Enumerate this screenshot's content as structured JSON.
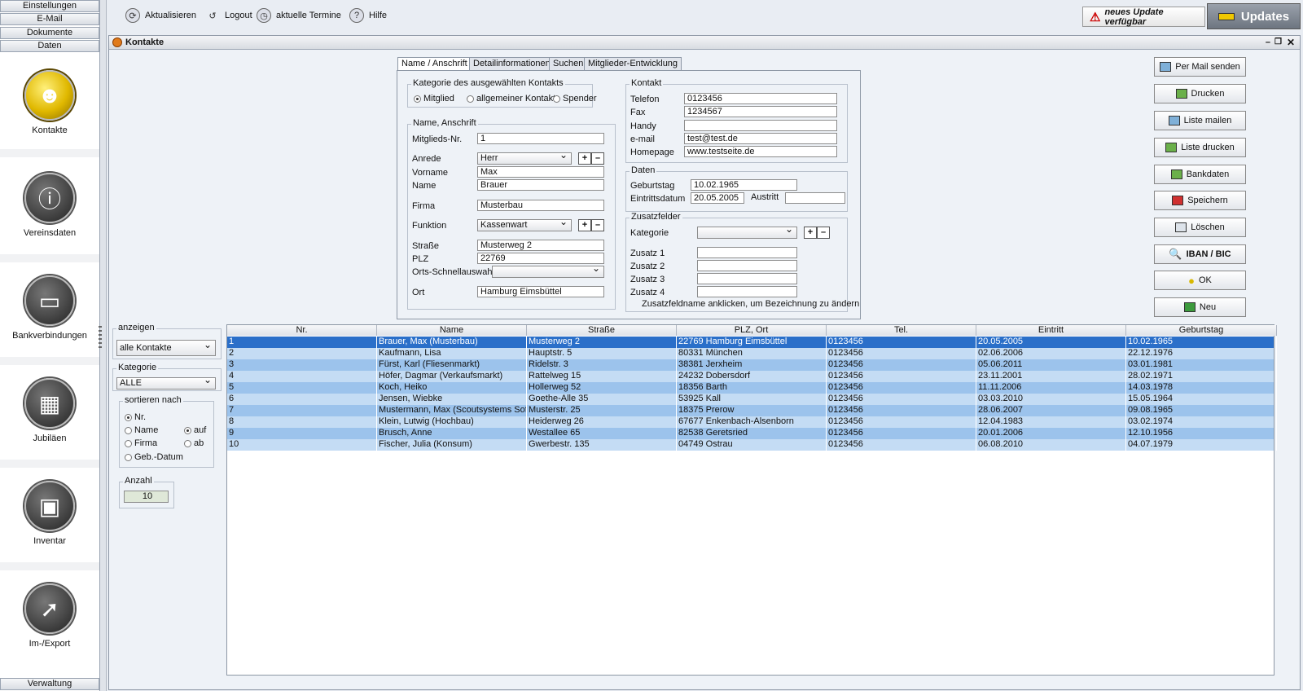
{
  "sidebar": {
    "top_menu": [
      "Einstellungen",
      "E-Mail",
      "Dokumente",
      "Daten"
    ],
    "items": [
      {
        "label": "Kontakte",
        "icon": "person-icon"
      },
      {
        "label": "Vereinsdaten",
        "icon": "info-icon"
      },
      {
        "label": "Bankverbindungen",
        "icon": "credit-card-icon"
      },
      {
        "label": "Jubiläen",
        "icon": "calendar-icon"
      },
      {
        "label": "Inventar",
        "icon": "briefcase-icon"
      },
      {
        "label": "Im-/Export",
        "icon": "export-icon"
      }
    ],
    "bottom_menu": "Verwaltung"
  },
  "toolbar": {
    "refresh": "Aktualisieren",
    "logout": "Logout",
    "appointments": "aktuelle Termine",
    "help": "Hilfe",
    "update_notice": "neues Update verfügbar",
    "updates_button": "Updates"
  },
  "window": {
    "title": "Kontakte"
  },
  "tabs": [
    "Name / Anschrift",
    "Detailinformationen",
    "Suchen",
    "Mitglieder-Entwicklung"
  ],
  "category": {
    "title": "Kategorie des ausgewählten Kontakts",
    "options": [
      "Mitglied",
      "allgemeiner Kontakt",
      "Spender"
    ],
    "selected": "Mitglied"
  },
  "name_address": {
    "title": "Name, Anschrift",
    "member_no_label": "Mitglieds-Nr.",
    "member_no": "1",
    "salutation_label": "Anrede",
    "salutation": "Herr",
    "firstname_label": "Vorname",
    "firstname": "Max",
    "lastname_label": "Name",
    "lastname": "Brauer",
    "company_label": "Firma",
    "company": "Musterbau",
    "function_label": "Funktion",
    "function": "Kassenwart",
    "street_label": "Straße",
    "street": "Musterweg 2",
    "zip_label": "PLZ",
    "zip": "22769",
    "quick_city_label": "Orts-Schnellauswahl",
    "quick_city": "",
    "city_label": "Ort",
    "city": "Hamburg Eimsbüttel"
  },
  "contact": {
    "title": "Kontakt",
    "phone_label": "Telefon",
    "phone": "0123456",
    "fax_label": "Fax",
    "fax": "1234567",
    "mobile_label": "Handy",
    "mobile": "",
    "email_label": "e-mail",
    "email": "test@test.de",
    "homepage_label": "Homepage",
    "homepage": "www.testseite.de"
  },
  "dates": {
    "title": "Daten",
    "birthday_label": "Geburtstag",
    "birthday": "10.02.1965",
    "entry_label": "Eintrittsdatum",
    "entry": "20.05.2005",
    "exit_label": "Austritt",
    "exit": ""
  },
  "extra": {
    "title": "Zusatzfelder",
    "category_label": "Kategorie",
    "category": "",
    "labels": [
      "Zusatz 1",
      "Zusatz 2",
      "Zusatz 3",
      "Zusatz 4"
    ],
    "values": [
      "",
      "",
      "",
      ""
    ],
    "hint": "Zusatzfeldname anklicken, um Bezeichnung zu ändern"
  },
  "actions": [
    "Per Mail senden",
    "Drucken",
    "Liste mailen",
    "Liste drucken",
    "Bankdaten",
    "Speichern",
    "Löschen",
    "IBAN / BIC",
    "OK",
    "Neu"
  ],
  "filter": {
    "show_label": "anzeigen",
    "show_value": "alle Kontakte",
    "category_label": "Kategorie",
    "category_value": "ALLE",
    "sort_label": "sortieren nach",
    "sort_fields": [
      "Nr.",
      "Name",
      "Firma",
      "Geb.-Datum"
    ],
    "sort_selected": "Nr.",
    "sort_dirs": [
      "auf",
      "ab"
    ],
    "sort_dir_selected": "auf",
    "count_label": "Anzahl",
    "count": "10"
  },
  "table": {
    "headers": [
      "Nr.",
      "Name",
      "Straße",
      "PLZ, Ort",
      "Tel.",
      "Eintritt",
      "Geburtstag"
    ],
    "rows": [
      [
        "1",
        "Brauer, Max (Musterbau)",
        "Musterweg 2",
        "22769 Hamburg Eimsbüttel",
        "0123456",
        "20.05.2005",
        "10.02.1965"
      ],
      [
        "2",
        "Kaufmann, Lisa",
        "Hauptstr. 5",
        "80331 München",
        "0123456",
        "02.06.2006",
        "22.12.1976"
      ],
      [
        "3",
        "Fürst, Karl (Fliesenmarkt)",
        "Ridelstr. 3",
        "38381 Jerxheim",
        "0123456",
        "05.06.2011",
        "03.01.1981"
      ],
      [
        "4",
        "Höfer, Dagmar (Verkaufsmarkt)",
        "Rattelweg 15",
        "24232 Dobersdorf",
        "0123456",
        "23.11.2001",
        "28.02.1971"
      ],
      [
        "5",
        "Koch, Heiko",
        "Hollerweg 52",
        "18356 Barth",
        "0123456",
        "11.11.2006",
        "14.03.1978"
      ],
      [
        "6",
        "Jensen, Wiebke",
        "Goethe-Alle 35",
        "53925 Kall",
        "0123456",
        "03.03.2010",
        "15.05.1964"
      ],
      [
        "7",
        "Mustermann, Max (Scoutsystems Soft...",
        "Musterstr. 25",
        "18375 Prerow",
        "0123456",
        "28.06.2007",
        "09.08.1965"
      ],
      [
        "8",
        "Klein, Lutwig (Hochbau)",
        "Heiderweg 26",
        "67677 Enkenbach-Alsenborn",
        "0123456",
        "12.04.1983",
        "03.02.1974"
      ],
      [
        "9",
        "Brusch, Anne",
        "Westallee 65",
        "82538 Geretsried",
        "0123456",
        "20.01.2006",
        "12.10.1956"
      ],
      [
        "10",
        "Fischer, Julia (Konsum)",
        "Gwerbestr. 135",
        "04749 Ostrau",
        "0123456",
        "06.08.2010",
        "04.07.1979"
      ]
    ]
  }
}
